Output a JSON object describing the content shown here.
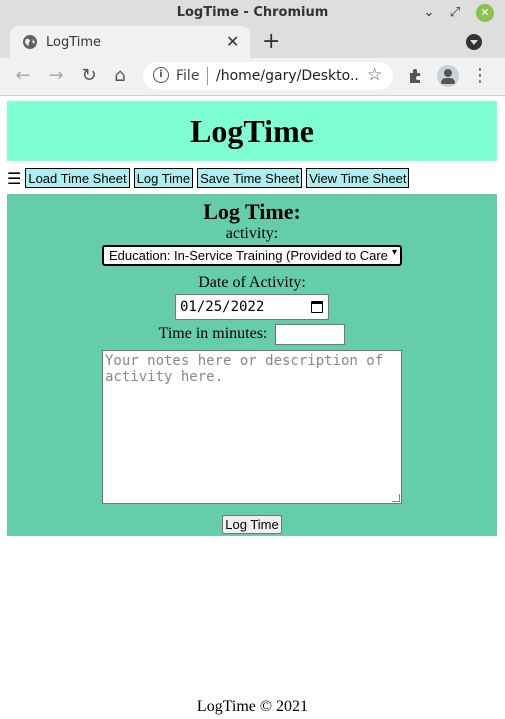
{
  "window": {
    "title": "LogTime - Chromium",
    "min_icon": "minimize-icon",
    "max_icon": "maximize-icon",
    "close_icon": "close-icon"
  },
  "tabs": [
    {
      "label": "LogTime",
      "icon": "globe-icon"
    }
  ],
  "toolbar": {
    "file_label": "File",
    "url": "/home/gary/Deskto..."
  },
  "page": {
    "header_title": "LogTime",
    "nav": {
      "menu_glyph": "☰",
      "items": [
        "Load Time Sheet",
        "Log Time",
        "Save Time Sheet",
        "View Time Sheet"
      ]
    },
    "form": {
      "heading": "Log Time:",
      "activity_label": "activity:",
      "activity_selected": "Education: In-Service Training (Provided to Care",
      "date_label": "Date of Activity:",
      "date_value": "01/25/2022",
      "time_label": "Time in minutes:",
      "time_value": "",
      "notes_placeholder": "Your notes here or description of activity here.",
      "submit_label": "Log Time"
    },
    "footer": "LogTime © 2021"
  }
}
